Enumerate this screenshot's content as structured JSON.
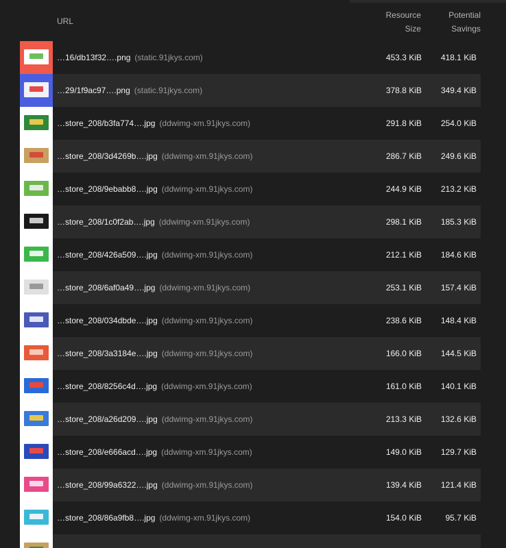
{
  "header": {
    "url": "URL",
    "resource_size_line1": "Resource",
    "resource_size_line2": "Size",
    "potential_savings_line1": "Potential",
    "potential_savings_line2": "Savings"
  },
  "rows": [
    {
      "file": "…16/db13f32….png",
      "host": "(static.91jkys.com)",
      "size": "453.3 KiB",
      "savings": "418.1 KiB",
      "thumb": {
        "bg": "#f05a4a",
        "fg": "#ffffff",
        "accent": "#6bbf5a"
      }
    },
    {
      "file": "…29/1f9ac97….png",
      "host": "(static.91jkys.com)",
      "size": "378.8 KiB",
      "savings": "349.4 KiB",
      "thumb": {
        "bg": "#4a5fe0",
        "fg": "#f2f2f8",
        "accent": "#e04a4a"
      }
    },
    {
      "file": "…store_208/b3fa774….jpg",
      "host": "(ddwimg-xm.91jkys.com)",
      "size": "291.8 KiB",
      "savings": "254.0 KiB",
      "thumb": {
        "bg": "#ffffff",
        "fg": "#2e8a3a",
        "accent": "#e8c84a"
      }
    },
    {
      "file": "…store_208/3d4269b….jpg",
      "host": "(ddwimg-xm.91jkys.com)",
      "size": "286.7 KiB",
      "savings": "249.6 KiB",
      "thumb": {
        "bg": "#ffffff",
        "fg": "#c8a060",
        "accent": "#d84a3a"
      }
    },
    {
      "file": "…store_208/9ebabb8….jpg",
      "host": "(ddwimg-xm.91jkys.com)",
      "size": "244.9 KiB",
      "savings": "213.2 KiB",
      "thumb": {
        "bg": "#ffffff",
        "fg": "#6ab84a",
        "accent": "#e8e8e8"
      }
    },
    {
      "file": "…store_208/1c0f2ab….jpg",
      "host": "(ddwimg-xm.91jkys.com)",
      "size": "298.1 KiB",
      "savings": "185.3 KiB",
      "thumb": {
        "bg": "#ffffff",
        "fg": "#1a1a1a",
        "accent": "#c8c8c8"
      }
    },
    {
      "file": "…store_208/426a509….jpg",
      "host": "(ddwimg-xm.91jkys.com)",
      "size": "212.1 KiB",
      "savings": "184.6 KiB",
      "thumb": {
        "bg": "#ffffff",
        "fg": "#3ab84a",
        "accent": "#e8f4e8"
      }
    },
    {
      "file": "…store_208/6af0a49….jpg",
      "host": "(ddwimg-xm.91jkys.com)",
      "size": "253.1 KiB",
      "savings": "157.4 KiB",
      "thumb": {
        "bg": "#ffffff",
        "fg": "#e0e0e0",
        "accent": "#9a9a9a"
      }
    },
    {
      "file": "…store_208/034dbde….jpg",
      "host": "(ddwimg-xm.91jkys.com)",
      "size": "238.6 KiB",
      "savings": "148.4 KiB",
      "thumb": {
        "bg": "#ffffff",
        "fg": "#4a5ab8",
        "accent": "#e0e4f4"
      }
    },
    {
      "file": "…store_208/3a3184e….jpg",
      "host": "(ddwimg-xm.91jkys.com)",
      "size": "166.0 KiB",
      "savings": "144.5 KiB",
      "thumb": {
        "bg": "#ffffff",
        "fg": "#e85a3a",
        "accent": "#f8c8b8"
      }
    },
    {
      "file": "…store_208/8256c4d….jpg",
      "host": "(ddwimg-xm.91jkys.com)",
      "size": "161.0 KiB",
      "savings": "140.1 KiB",
      "thumb": {
        "bg": "#ffffff",
        "fg": "#2a6ad8",
        "accent": "#e84a3a"
      }
    },
    {
      "file": "…store_208/a26d209….jpg",
      "host": "(ddwimg-xm.91jkys.com)",
      "size": "213.3 KiB",
      "savings": "132.6 KiB",
      "thumb": {
        "bg": "#ffffff",
        "fg": "#3a7ad8",
        "accent": "#e8c84a"
      }
    },
    {
      "file": "…store_208/e666acd….jpg",
      "host": "(ddwimg-xm.91jkys.com)",
      "size": "149.0 KiB",
      "savings": "129.7 KiB",
      "thumb": {
        "bg": "#ffffff",
        "fg": "#2a4ab8",
        "accent": "#e84a4a"
      }
    },
    {
      "file": "…store_208/99a6322….jpg",
      "host": "(ddwimg-xm.91jkys.com)",
      "size": "139.4 KiB",
      "savings": "121.4 KiB",
      "thumb": {
        "bg": "#ffffff",
        "fg": "#e84a8a",
        "accent": "#f8d8e8"
      }
    },
    {
      "file": "…store_208/86a9fb8….jpg",
      "host": "(ddwimg-xm.91jkys.com)",
      "size": "154.0 KiB",
      "savings": "95.7 KiB",
      "thumb": {
        "bg": "#ffffff",
        "fg": "#3ab8d8",
        "accent": "#e8f4f8"
      }
    },
    {
      "file": "",
      "host": "",
      "size": "",
      "savings": "",
      "thumb": {
        "bg": "#ffffff",
        "fg": "#c8a060",
        "accent": "#3a8a3a"
      }
    }
  ]
}
